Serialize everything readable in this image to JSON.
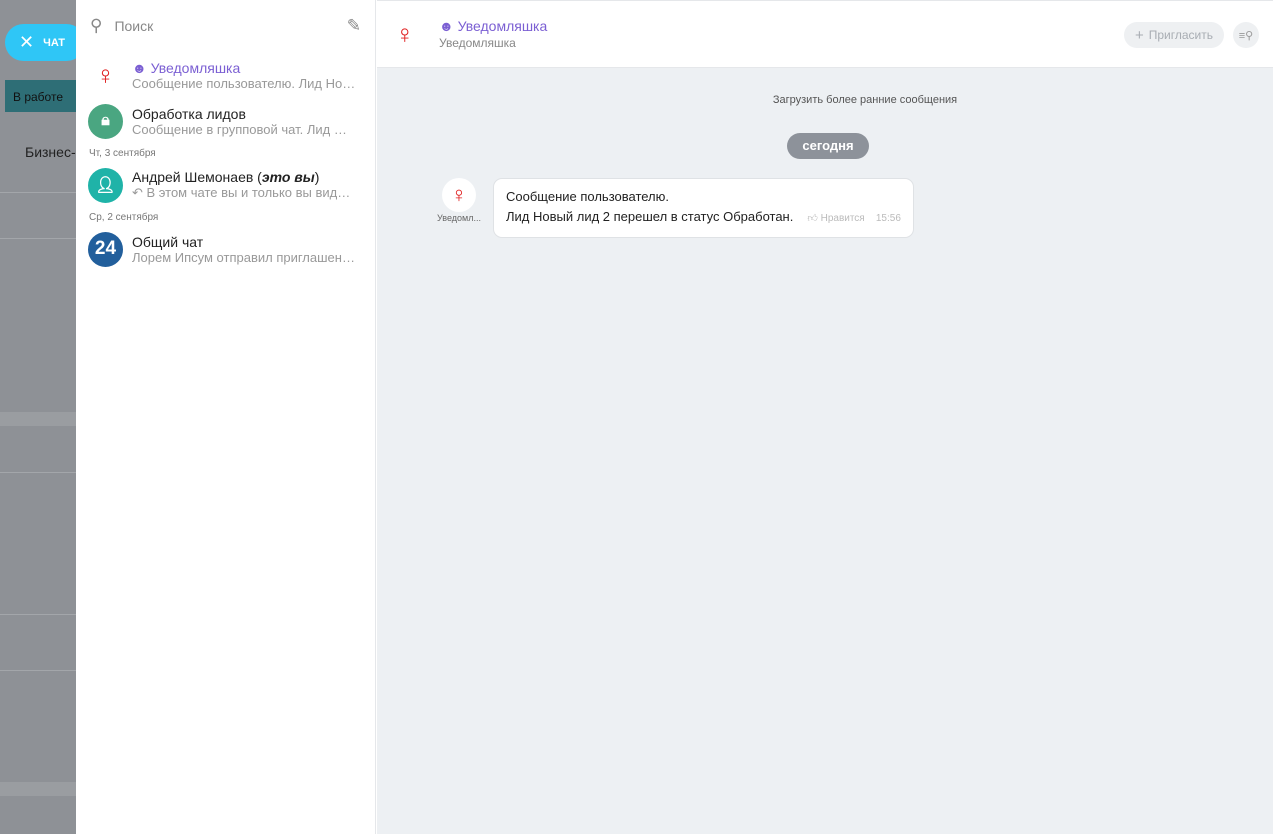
{
  "background": {
    "chat_button": "ЧАТ",
    "status": "В работе",
    "business": "Бизнес-"
  },
  "sidebar": {
    "search_placeholder": "Поиск",
    "items": [
      {
        "name": "Уведомляшка",
        "preview": "Сообщение пользователю. Лид Но…",
        "bot": true
      },
      {
        "name": "Обработка лидов",
        "preview": "Сообщение в групповой чат. Лид  …"
      },
      {
        "date": "Чт, 3 сентября",
        "name": "Андрей Шемонаев",
        "self_tag": "это вы",
        "preview": "В этом чате вы и только вы вид…"
      },
      {
        "date": "Ср, 2 сентября",
        "name": "Общий чат",
        "preview": "Лорем Ипсум отправил приглашен…",
        "avatar_text": "24"
      }
    ]
  },
  "header": {
    "title": "Уведомляшка",
    "subtitle": "Уведомляшка",
    "invite": "Пригласить"
  },
  "chat": {
    "load_earlier": "Загрузить более ранние сообщения",
    "date_divider": "сегодня",
    "message": {
      "author_short": "Уведомл...",
      "line1": "Сообщение пользователю.",
      "line2": "Лид Новый лид 2 перешел в статус Обработан.",
      "like": "Нравится",
      "time": "15:56"
    }
  },
  "colors": {
    "accent": "#2fc6f6",
    "bot": "#7b5fd3"
  }
}
